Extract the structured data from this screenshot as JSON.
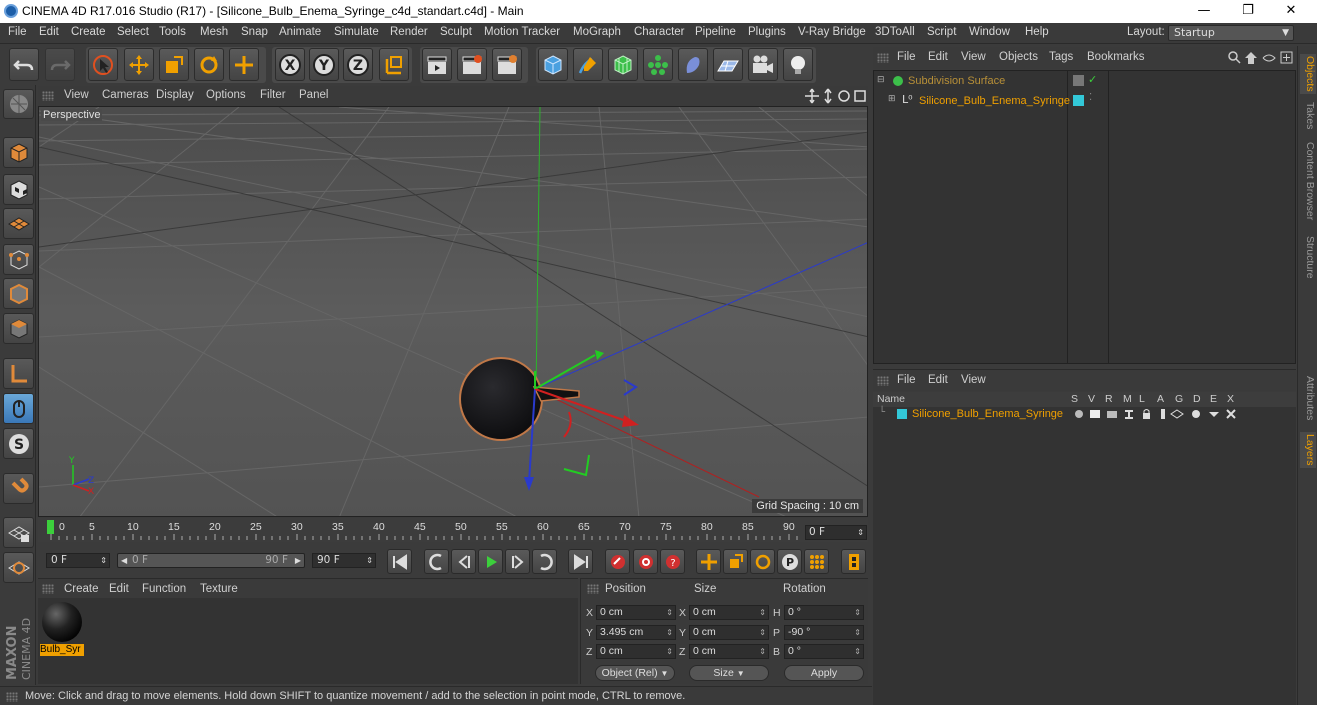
{
  "window": {
    "title": "CINEMA 4D R17.016 Studio (R17) - [Silicone_Bulb_Enema_Syringe_c4d_standart.c4d] - Main",
    "minimize": "—",
    "restore": "❐",
    "close": "✕"
  },
  "menu": [
    "File",
    "Edit",
    "Create",
    "Select",
    "Tools",
    "Mesh",
    "Snap",
    "Animate",
    "Simulate",
    "Render",
    "Sculpt",
    "Motion Tracker",
    "MoGraph",
    "Character",
    "Pipeline",
    "Plugins",
    "V-Ray Bridge",
    "3DToAll",
    "Script",
    "Window",
    "Help"
  ],
  "layout": {
    "label": "Layout:",
    "value": "Startup"
  },
  "viewport": {
    "menu": [
      "View",
      "Cameras",
      "Display",
      "Options",
      "Filter",
      "Panel"
    ],
    "camera_label": "Perspective",
    "grid_spacing": "Grid Spacing : 10 cm"
  },
  "timeline": {
    "ticks": [
      "0",
      "5",
      "10",
      "15",
      "20",
      "25",
      "30",
      "35",
      "40",
      "45",
      "50",
      "55",
      "60",
      "65",
      "70",
      "75",
      "80",
      "85",
      "90"
    ],
    "current_frame": "0 F"
  },
  "playback": {
    "start": "0 F",
    "range_start": "0 F",
    "range_end": "90 F",
    "end": "90 F"
  },
  "material_manager": {
    "menu": [
      "Create",
      "Edit",
      "Function",
      "Texture"
    ],
    "material_name": "Bulb_Syr"
  },
  "coordinates": {
    "headers": [
      "Position",
      "Size",
      "Rotation"
    ],
    "rows": [
      {
        "axis": "X",
        "pos": "0 cm",
        "saxis": "X",
        "size": "0 cm",
        "raxis": "H",
        "rot": "0 °"
      },
      {
        "axis": "Y",
        "pos": "3.495 cm",
        "saxis": "Y",
        "size": "0 cm",
        "raxis": "P",
        "rot": "-90 °"
      },
      {
        "axis": "Z",
        "pos": "0 cm",
        "saxis": "Z",
        "size": "0 cm",
        "raxis": "B",
        "rot": "0 °"
      }
    ],
    "mode": "Object (Rel)",
    "size_mode": "Size",
    "apply": "Apply"
  },
  "status": "Move: Click and drag to move elements. Hold down SHIFT to quantize movement / add to the selection in point mode, CTRL to remove.",
  "object_manager": {
    "menu": [
      "File",
      "Edit",
      "View",
      "Objects",
      "Tags",
      "Bookmarks"
    ],
    "objects": [
      {
        "name": "Subdivision Surface"
      },
      {
        "name": "Silicone_Bulb_Enema_Syringe"
      }
    ]
  },
  "layer_manager": {
    "menu": [
      "File",
      "Edit",
      "View"
    ],
    "columns": [
      "Name",
      "S",
      "V",
      "R",
      "M",
      "L",
      "A",
      "G",
      "D",
      "E",
      "X"
    ],
    "layers": [
      {
        "name": "Silicone_Bulb_Enema_Syringe",
        "color": "#33c8d8"
      }
    ]
  },
  "right_tabs": [
    "Objects",
    "Takes",
    "Content Browser",
    "Structure",
    "Attributes",
    "Layers"
  ],
  "brand": {
    "line1": "MAXON",
    "line2": "CINEMA 4D"
  },
  "colors": {
    "accent": "#f0a000",
    "layer": "#33c8d8"
  }
}
